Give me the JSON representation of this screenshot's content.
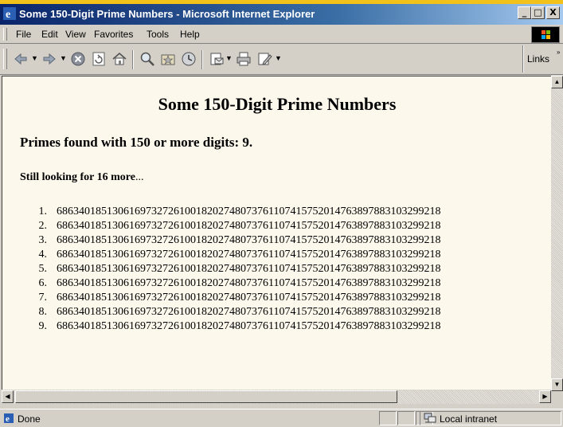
{
  "window": {
    "title": "Some 150-Digit Prime Numbers - Microsoft Internet Explorer",
    "minimize_glyph": "_",
    "maximize_glyph": "□",
    "close_glyph": "X"
  },
  "menu": {
    "file": "File",
    "edit": "Edit",
    "view": "View",
    "favorites": "Favorites",
    "tools": "Tools",
    "help": "Help"
  },
  "toolbar": {
    "icons": [
      "back-icon",
      "forward-icon",
      "stop-icon",
      "refresh-icon",
      "home-icon",
      "search-icon",
      "favorites-icon",
      "history-icon",
      "mail-icon",
      "print-icon",
      "edit-icon"
    ],
    "links_label": "Links"
  },
  "page": {
    "heading": "Some 150-Digit Prime Numbers",
    "found_label": "Primes found with 150 or more digits: 9.",
    "looking_label": "Still looking for 16 more",
    "looking_ellipsis": "...",
    "primes": [
      {
        "num": "1.",
        "value": "686340185130616973272610018202748073761107415752014763897883103299218"
      },
      {
        "num": "2.",
        "value": "686340185130616973272610018202748073761107415752014763897883103299218"
      },
      {
        "num": "3.",
        "value": "686340185130616973272610018202748073761107415752014763897883103299218"
      },
      {
        "num": "4.",
        "value": "686340185130616973272610018202748073761107415752014763897883103299218"
      },
      {
        "num": "5.",
        "value": "686340185130616973272610018202748073761107415752014763897883103299218"
      },
      {
        "num": "6.",
        "value": "686340185130616973272610018202748073761107415752014763897883103299218"
      },
      {
        "num": "7.",
        "value": "686340185130616973272610018202748073761107415752014763897883103299218"
      },
      {
        "num": "8.",
        "value": "686340185130616973272610018202748073761107415752014763897883103299218"
      },
      {
        "num": "9.",
        "value": "686340185130616973272610018202748073761107415752014763897883103299218"
      }
    ]
  },
  "status": {
    "text": "Done",
    "zone": "Local intranet"
  }
}
